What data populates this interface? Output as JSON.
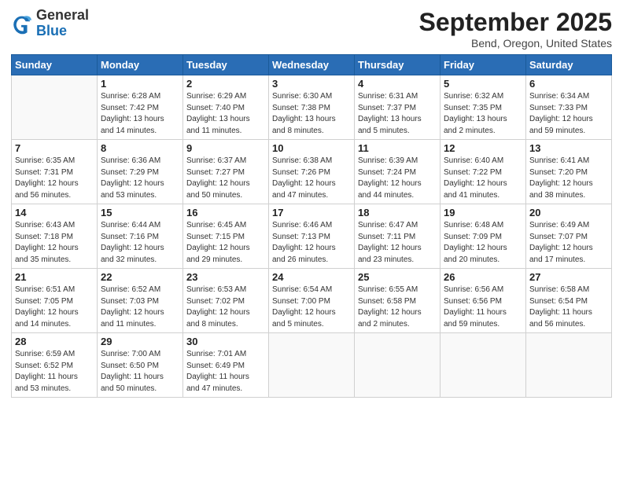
{
  "logo": {
    "general": "General",
    "blue": "Blue"
  },
  "title": "September 2025",
  "location": "Bend, Oregon, United States",
  "days_of_week": [
    "Sunday",
    "Monday",
    "Tuesday",
    "Wednesday",
    "Thursday",
    "Friday",
    "Saturday"
  ],
  "weeks": [
    [
      {
        "day": "",
        "info": ""
      },
      {
        "day": "1",
        "info": "Sunrise: 6:28 AM\nSunset: 7:42 PM\nDaylight: 13 hours\nand 14 minutes."
      },
      {
        "day": "2",
        "info": "Sunrise: 6:29 AM\nSunset: 7:40 PM\nDaylight: 13 hours\nand 11 minutes."
      },
      {
        "day": "3",
        "info": "Sunrise: 6:30 AM\nSunset: 7:38 PM\nDaylight: 13 hours\nand 8 minutes."
      },
      {
        "day": "4",
        "info": "Sunrise: 6:31 AM\nSunset: 7:37 PM\nDaylight: 13 hours\nand 5 minutes."
      },
      {
        "day": "5",
        "info": "Sunrise: 6:32 AM\nSunset: 7:35 PM\nDaylight: 13 hours\nand 2 minutes."
      },
      {
        "day": "6",
        "info": "Sunrise: 6:34 AM\nSunset: 7:33 PM\nDaylight: 12 hours\nand 59 minutes."
      }
    ],
    [
      {
        "day": "7",
        "info": "Sunrise: 6:35 AM\nSunset: 7:31 PM\nDaylight: 12 hours\nand 56 minutes."
      },
      {
        "day": "8",
        "info": "Sunrise: 6:36 AM\nSunset: 7:29 PM\nDaylight: 12 hours\nand 53 minutes."
      },
      {
        "day": "9",
        "info": "Sunrise: 6:37 AM\nSunset: 7:27 PM\nDaylight: 12 hours\nand 50 minutes."
      },
      {
        "day": "10",
        "info": "Sunrise: 6:38 AM\nSunset: 7:26 PM\nDaylight: 12 hours\nand 47 minutes."
      },
      {
        "day": "11",
        "info": "Sunrise: 6:39 AM\nSunset: 7:24 PM\nDaylight: 12 hours\nand 44 minutes."
      },
      {
        "day": "12",
        "info": "Sunrise: 6:40 AM\nSunset: 7:22 PM\nDaylight: 12 hours\nand 41 minutes."
      },
      {
        "day": "13",
        "info": "Sunrise: 6:41 AM\nSunset: 7:20 PM\nDaylight: 12 hours\nand 38 minutes."
      }
    ],
    [
      {
        "day": "14",
        "info": "Sunrise: 6:43 AM\nSunset: 7:18 PM\nDaylight: 12 hours\nand 35 minutes."
      },
      {
        "day": "15",
        "info": "Sunrise: 6:44 AM\nSunset: 7:16 PM\nDaylight: 12 hours\nand 32 minutes."
      },
      {
        "day": "16",
        "info": "Sunrise: 6:45 AM\nSunset: 7:15 PM\nDaylight: 12 hours\nand 29 minutes."
      },
      {
        "day": "17",
        "info": "Sunrise: 6:46 AM\nSunset: 7:13 PM\nDaylight: 12 hours\nand 26 minutes."
      },
      {
        "day": "18",
        "info": "Sunrise: 6:47 AM\nSunset: 7:11 PM\nDaylight: 12 hours\nand 23 minutes."
      },
      {
        "day": "19",
        "info": "Sunrise: 6:48 AM\nSunset: 7:09 PM\nDaylight: 12 hours\nand 20 minutes."
      },
      {
        "day": "20",
        "info": "Sunrise: 6:49 AM\nSunset: 7:07 PM\nDaylight: 12 hours\nand 17 minutes."
      }
    ],
    [
      {
        "day": "21",
        "info": "Sunrise: 6:51 AM\nSunset: 7:05 PM\nDaylight: 12 hours\nand 14 minutes."
      },
      {
        "day": "22",
        "info": "Sunrise: 6:52 AM\nSunset: 7:03 PM\nDaylight: 12 hours\nand 11 minutes."
      },
      {
        "day": "23",
        "info": "Sunrise: 6:53 AM\nSunset: 7:02 PM\nDaylight: 12 hours\nand 8 minutes."
      },
      {
        "day": "24",
        "info": "Sunrise: 6:54 AM\nSunset: 7:00 PM\nDaylight: 12 hours\nand 5 minutes."
      },
      {
        "day": "25",
        "info": "Sunrise: 6:55 AM\nSunset: 6:58 PM\nDaylight: 12 hours\nand 2 minutes."
      },
      {
        "day": "26",
        "info": "Sunrise: 6:56 AM\nSunset: 6:56 PM\nDaylight: 11 hours\nand 59 minutes."
      },
      {
        "day": "27",
        "info": "Sunrise: 6:58 AM\nSunset: 6:54 PM\nDaylight: 11 hours\nand 56 minutes."
      }
    ],
    [
      {
        "day": "28",
        "info": "Sunrise: 6:59 AM\nSunset: 6:52 PM\nDaylight: 11 hours\nand 53 minutes."
      },
      {
        "day": "29",
        "info": "Sunrise: 7:00 AM\nSunset: 6:50 PM\nDaylight: 11 hours\nand 50 minutes."
      },
      {
        "day": "30",
        "info": "Sunrise: 7:01 AM\nSunset: 6:49 PM\nDaylight: 11 hours\nand 47 minutes."
      },
      {
        "day": "",
        "info": ""
      },
      {
        "day": "",
        "info": ""
      },
      {
        "day": "",
        "info": ""
      },
      {
        "day": "",
        "info": ""
      }
    ]
  ]
}
